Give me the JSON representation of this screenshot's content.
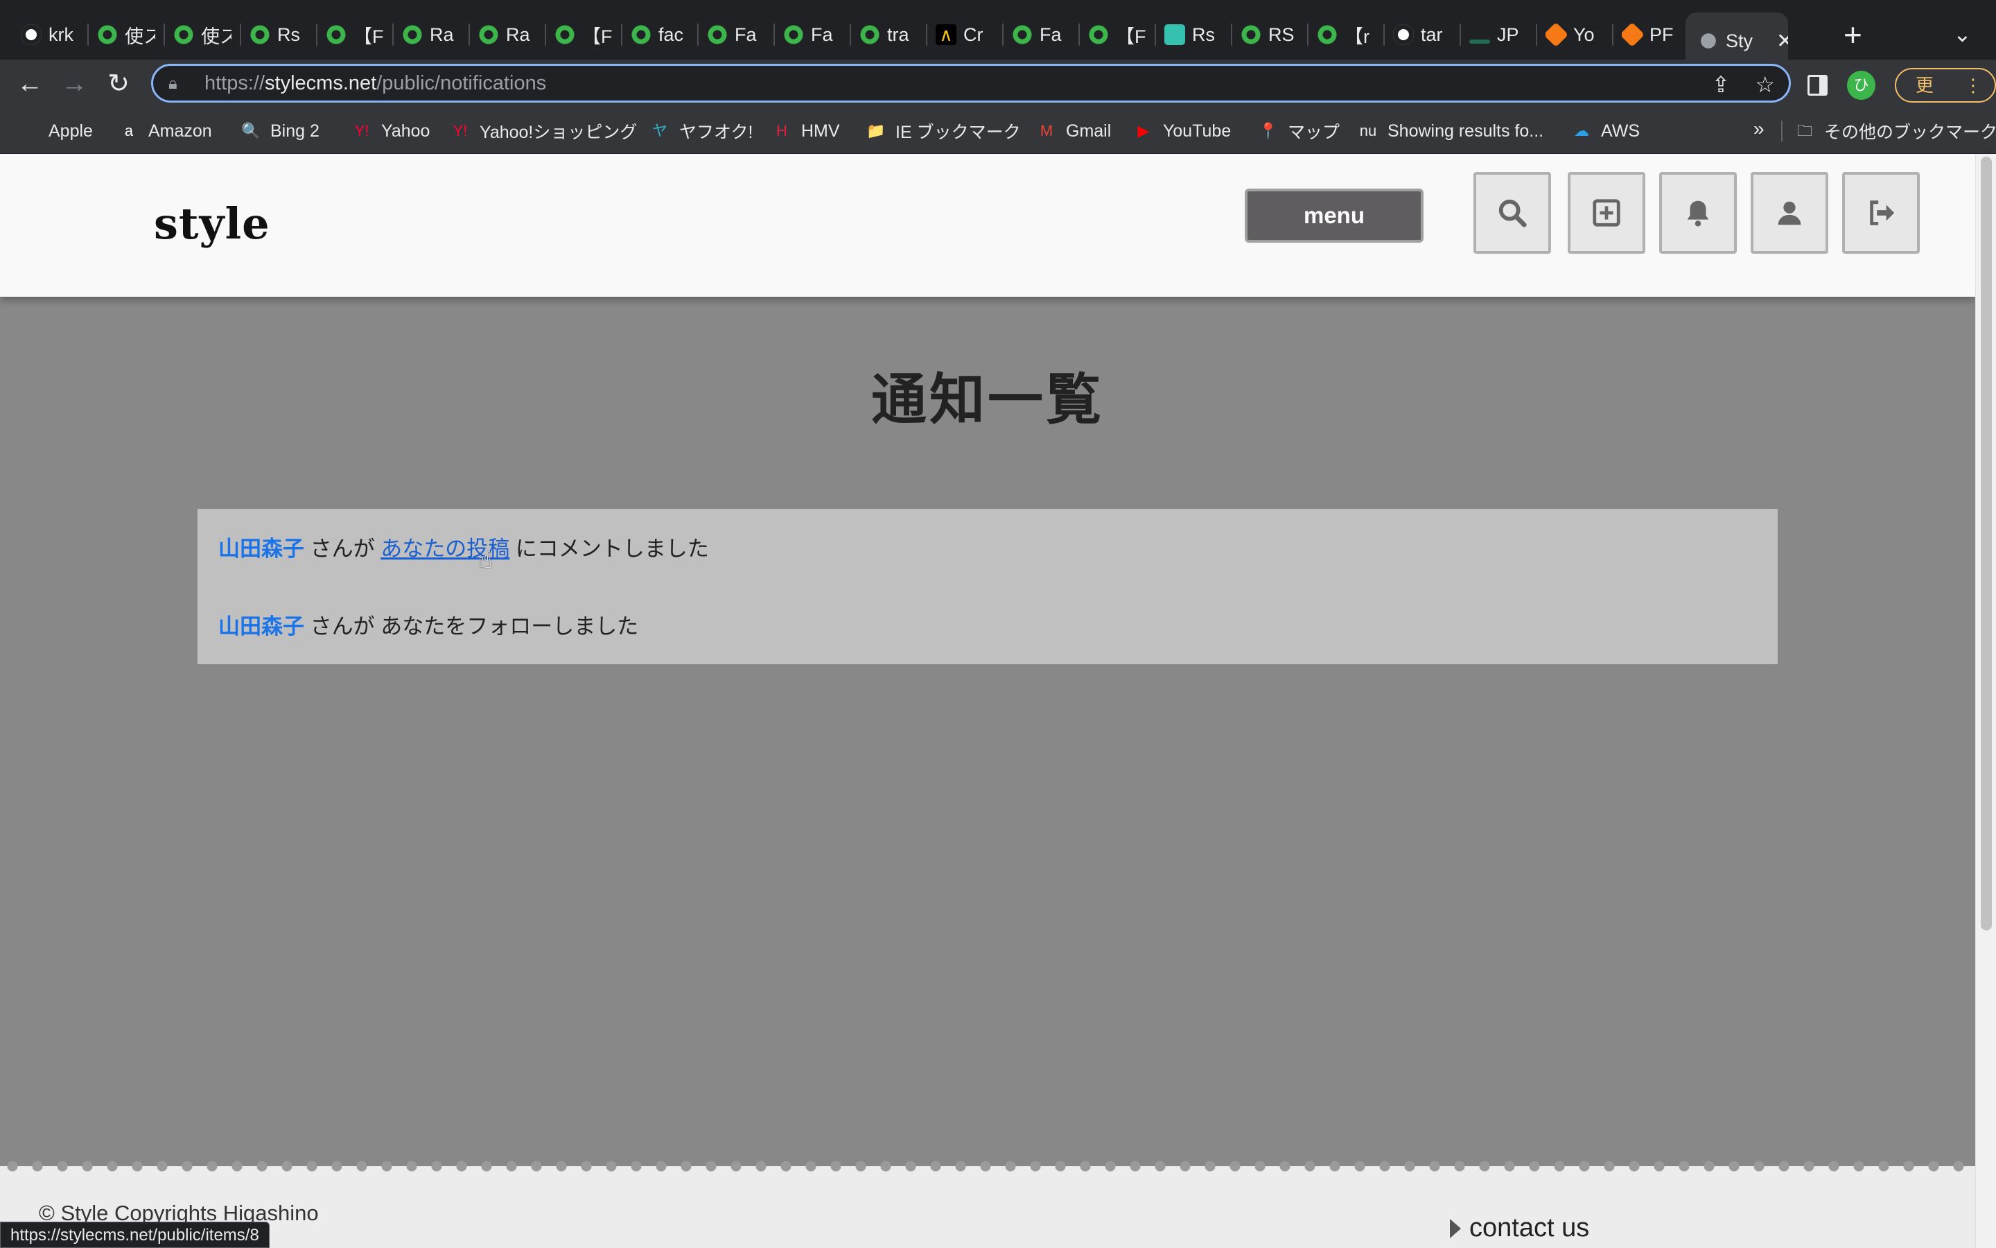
{
  "browser": {
    "tabs": [
      {
        "title": "krk",
        "icon": "github"
      },
      {
        "title": "使ス",
        "icon": "green"
      },
      {
        "title": "使ス",
        "icon": "green"
      },
      {
        "title": "Rs",
        "icon": "green"
      },
      {
        "title": "【F",
        "icon": "green"
      },
      {
        "title": "Ra",
        "icon": "green"
      },
      {
        "title": "Ra",
        "icon": "green"
      },
      {
        "title": "【F",
        "icon": "green"
      },
      {
        "title": "fac",
        "icon": "green"
      },
      {
        "title": "Fa",
        "icon": "green"
      },
      {
        "title": "Fa",
        "icon": "green"
      },
      {
        "title": "tra",
        "icon": "green"
      },
      {
        "title": "Cr",
        "icon": "cr"
      },
      {
        "title": "Fa",
        "icon": "green"
      },
      {
        "title": "【F",
        "icon": "green"
      },
      {
        "title": "Rs",
        "icon": "rs"
      },
      {
        "title": "RS",
        "icon": "green"
      },
      {
        "title": "【r",
        "icon": "green"
      },
      {
        "title": "tar",
        "icon": "github"
      },
      {
        "title": "JP",
        "icon": "jp"
      },
      {
        "title": "Yo",
        "icon": "box"
      },
      {
        "title": "PF",
        "icon": "box"
      },
      {
        "title": "Sty",
        "icon": "globe"
      }
    ],
    "active_tab_close": "✕",
    "new_tab": "+",
    "url_scheme": "https://",
    "url_host": "stylecms.net",
    "url_path": "/public/notifications",
    "profile_initial": "ひ",
    "update_label": "更新",
    "bookmarks": [
      {
        "label": "Apple",
        "icon": ""
      },
      {
        "label": "Amazon",
        "icon": "a"
      },
      {
        "label": "Bing 2",
        "icon": "🔍"
      },
      {
        "label": "Yahoo",
        "icon": "Y!"
      },
      {
        "label": "Yahoo!ショッピング",
        "icon": "Y!"
      },
      {
        "label": "ヤフオク!",
        "icon": "ヤ"
      },
      {
        "label": "HMV",
        "icon": "H"
      },
      {
        "label": "IE ブックマーク",
        "icon": "📁"
      },
      {
        "label": "Gmail",
        "icon": "M"
      },
      {
        "label": "YouTube",
        "icon": "▶"
      },
      {
        "label": "マップ",
        "icon": "📍"
      },
      {
        "label": "Showing results fo...",
        "icon": "nu"
      },
      {
        "label": "AWS",
        "icon": "☁"
      }
    ],
    "bookmarks_overflow": "»",
    "other_bookmarks": "その他のブックマーク",
    "status_url": "https://stylecms.net/public/items/8"
  },
  "site": {
    "logo": "style",
    "menu_label": "menu",
    "page_title": "通知一覧",
    "notifications": [
      {
        "user": "山田森子",
        "pre": "さんが",
        "link": "あなたの投稿",
        "post": "にコメントしました"
      },
      {
        "user": "山田森子",
        "pre": "さんが",
        "text": "あなたをフォローしました"
      }
    ],
    "footer": {
      "copyright": "© Style Copyrights Higashino",
      "contact": "contact us"
    }
  },
  "colors": {
    "page_bg": "#888888",
    "header_bg": "#f9f9f9",
    "notif_bg": "#c0c0c0",
    "link_blue": "#1a73e8",
    "menu_bg": "#5f5d5f"
  }
}
